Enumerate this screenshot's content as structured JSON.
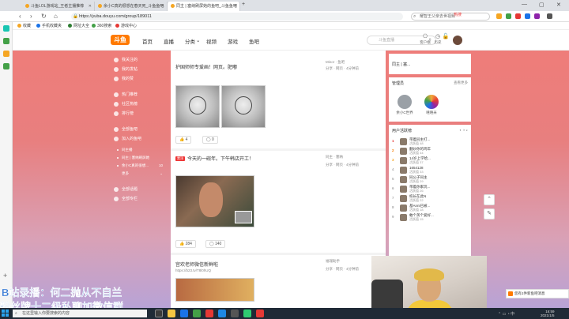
{
  "browser": {
    "tabs": [
      {
        "label": "斗鱼LOL游戏站_王者主播推荐"
      },
      {
        "label": "余小C真的很想在春天死_斗鱼鱼吧"
      },
      {
        "label": "同主 | 塞纳刷屏她的鱼吧_斗鱼鱼吧"
      }
    ],
    "url": "https://yuba.douyu.com/group/189011",
    "search_placeholder": "耀智王父亲去世视频",
    "hot_label": "热搜"
  },
  "bookmarks": [
    {
      "label": "收藏",
      "color": "#f5a623"
    },
    {
      "label": "手机收藏夹",
      "color": "#1a73e8"
    },
    {
      "label": "网址大全",
      "color": "#2e7d32"
    },
    {
      "label": "360搜索",
      "color": "#43a047"
    },
    {
      "label": "游戏中心",
      "color": "#e53935"
    }
  ],
  "header": {
    "logo": "斗鱼",
    "nav": [
      "首页",
      "直播",
      "分类",
      "视频",
      "游戏",
      "鱼吧"
    ],
    "search_placeholder": "斗鱼直播",
    "icons": [
      {
        "label": "客户端",
        "icon": "client-icon"
      },
      {
        "label": "历史",
        "icon": "history-icon"
      },
      {
        "label": "",
        "icon": "lock-icon"
      }
    ]
  },
  "sidenav": {
    "items": [
      {
        "label": "我关注的",
        "sub": false
      },
      {
        "label": "我的发帖",
        "sub": false
      },
      {
        "label": "我的赞",
        "sub": false
      },
      {
        "label": "热门推荐",
        "sub": false
      },
      {
        "label": "社区热榜",
        "sub": false
      },
      {
        "label": "排行榜",
        "sub": false
      },
      {
        "label": "全部鱼吧",
        "sub": false
      },
      {
        "label": "加入的鱼吧",
        "sub": false
      },
      {
        "label": "同主播",
        "sub": true,
        "count": ""
      },
      {
        "label": "同主 | 塞纳刷屏她",
        "sub": true,
        "count": ""
      },
      {
        "label": "余小C真的很想...",
        "sub": true,
        "count": "10"
      },
      {
        "label": "更多",
        "sub": true,
        "count": ""
      },
      {
        "label": "全部话题",
        "sub": false
      },
      {
        "label": "全部专栏",
        "sub": false
      }
    ]
  },
  "feed": {
    "post1": {
      "title": "护国师师专爱画！网页。肥嘟",
      "author": "Minor · 鱼吧",
      "meta": "分享 · 网页 · 4分钟前",
      "likes": "4",
      "comments": "0"
    },
    "post2": {
      "tag": "置顶",
      "title": "今天的一碗年。下午韩店开工！",
      "author": "同主 · 塞纳",
      "meta": "分享 · 网页 · 4分钟前",
      "likes": "284",
      "comments": "140"
    },
    "post3": {
      "title": "宫欢老师微信新鲜啦",
      "url": "https://b23.tv/T8l0hUQ",
      "author": "福瑞助手",
      "meta": "分享 · 网页 · 4分钟前"
    }
  },
  "right": {
    "profile_snippet": "同主 | 塞...",
    "admins_title": "管理员",
    "admins_more": "查看更多",
    "admins": [
      {
        "name": "余小C世界",
        "color": "#9aa0a6"
      },
      {
        "name": "嘻嘻米",
        "color": "#f2a83a"
      }
    ],
    "ranking_title": "用户活跃榜",
    "ranking": [
      {
        "n": "1",
        "name": "带着同主打...",
        "lv": "活跃值 48"
      },
      {
        "n": "2",
        "name": "翻炒你的鸡年",
        "lv": "活跃值 44"
      },
      {
        "n": "3",
        "name": "14岁上学哈...",
        "lv": "活跃值 37"
      },
      {
        "n": "4",
        "name": "1654128",
        "lv": "活跃值 33"
      },
      {
        "n": "5",
        "name": "同公子同主",
        "lv": "活跃值 29"
      },
      {
        "n": "6",
        "name": "带着你家玩...",
        "lv": "活跃值 26"
      },
      {
        "n": "7",
        "name": "校长在此N",
        "lv": "活跃值 22"
      },
      {
        "n": "8",
        "name": "基Anni已被...",
        "lv": "活跃值 18"
      },
      {
        "n": "9",
        "name": "敢个英个爱好...",
        "lv": "活跃值 15"
      }
    ]
  },
  "overlay": {
    "line1": "B站录播：何二抛从不自兰",
    "line2": "粉丝牌十二级私聊加微信群"
  },
  "toast": "您有1件新鱼吧消息",
  "taskbar": {
    "search_placeholder": "在这里输入你要搜索的内容",
    "time": "16:59",
    "date": "2021/1/5"
  }
}
